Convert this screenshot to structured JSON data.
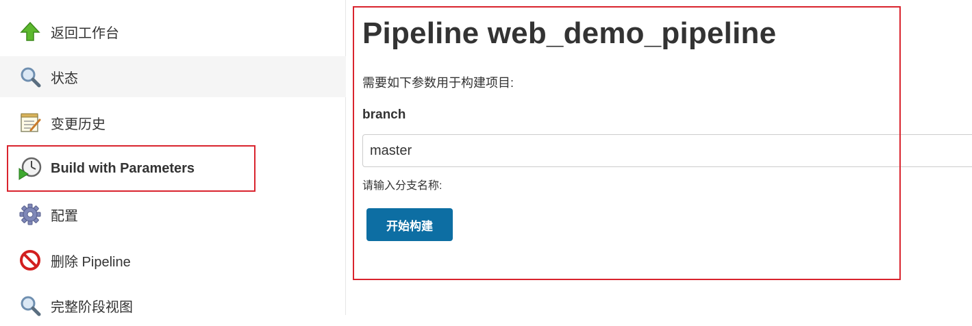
{
  "sidebar": {
    "items": [
      {
        "label": "返回工作台",
        "icon": "up-arrow-icon"
      },
      {
        "label": "状态",
        "icon": "search-icon"
      },
      {
        "label": "变更历史",
        "icon": "notepad-icon"
      },
      {
        "label": "Build with Parameters",
        "icon": "clock-play-icon"
      },
      {
        "label": "配置",
        "icon": "gear-icon"
      },
      {
        "label": "删除 Pipeline",
        "icon": "no-entry-icon"
      },
      {
        "label": "完整阶段视图",
        "icon": "search-icon"
      }
    ]
  },
  "main": {
    "title": "Pipeline web_demo_pipeline",
    "description": "需要如下参数用于构建项目:",
    "parameter": {
      "name": "branch",
      "value": "master",
      "help": "请输入分支名称:"
    },
    "build_button": "开始构建"
  },
  "colors": {
    "highlight": "#d9232d",
    "button": "#0d6ea3",
    "active_bg": "#f5f5f5"
  }
}
